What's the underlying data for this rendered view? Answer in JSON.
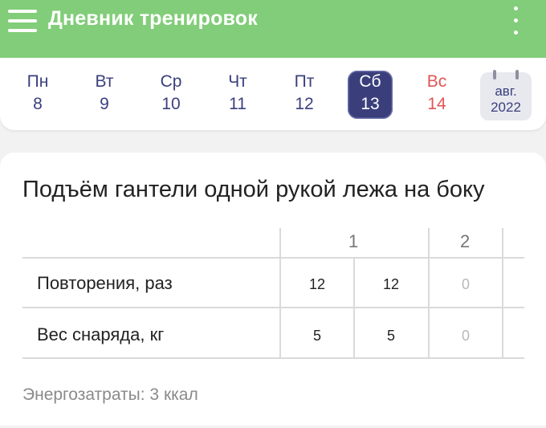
{
  "appbar": {
    "title": "Дневник тренировок",
    "menu_icon": "hamburger-menu-icon",
    "more_icon": "more-vert-icon",
    "color": "#82cd79"
  },
  "week": {
    "days": [
      {
        "name": "Пн",
        "num": "8"
      },
      {
        "name": "Вт",
        "num": "9"
      },
      {
        "name": "Ср",
        "num": "10"
      },
      {
        "name": "Чт",
        "num": "11"
      },
      {
        "name": "Пт",
        "num": "12"
      },
      {
        "name": "Сб",
        "num": "13"
      },
      {
        "name": "Вс",
        "num": "14"
      }
    ],
    "selected_index": 5,
    "calendar": {
      "month": "авг.",
      "year": "2022",
      "icon": "calendar-icon"
    },
    "selected_color": "#3a3f7c",
    "sunday_color": "#e05555"
  },
  "exercise": {
    "title": "Подъём гантели одной рукой лежа на боку",
    "sets": [
      "1",
      "2"
    ],
    "rows": [
      {
        "label": "Повторения, раз",
        "values": [
          "12",
          "12",
          "0"
        ]
      },
      {
        "label": "Вес снаряда, кг",
        "values": [
          "5",
          "5",
          "0"
        ]
      }
    ],
    "energy": "Энергозатраты: 3 ккал"
  }
}
